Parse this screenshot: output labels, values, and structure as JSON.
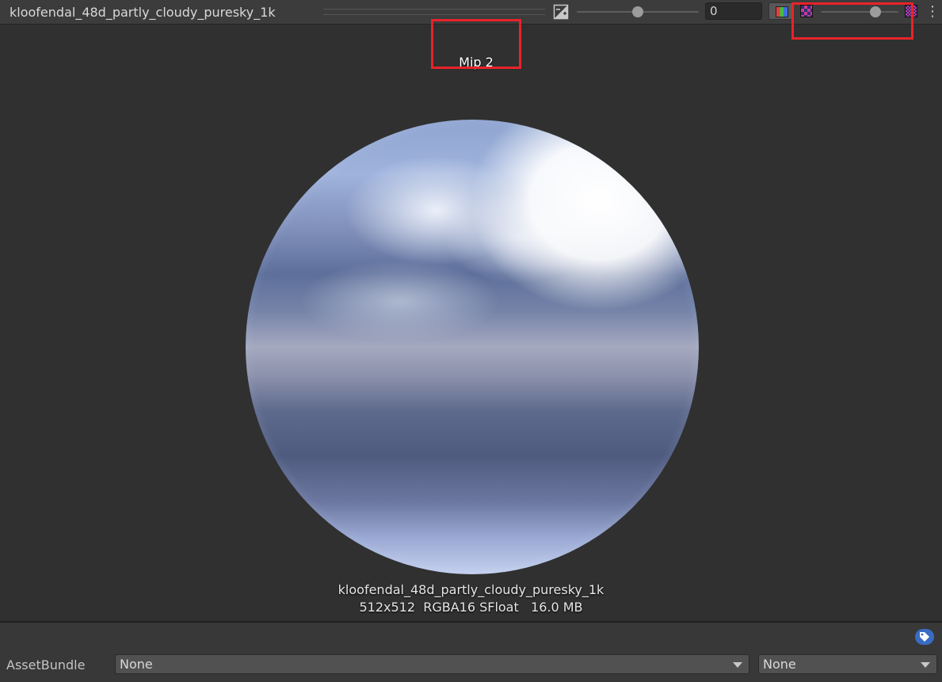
{
  "toolbar": {
    "title": "kloofendal_48d_partly_cloudy_puresky_1k",
    "exposure_icon": "exposure-icon",
    "exposure_value": "0",
    "exposure_slider_level": 0.5,
    "channel_icon": "rgb-channels-icon",
    "mip_small_icon": "mip-small-checker-icon",
    "mip_large_icon": "mip-large-checker-icon",
    "mip_slider_level": 0.7,
    "more_icon": "more-vertical-icon",
    "more_glyph": "⋮",
    "highlight_color": "#e8232a"
  },
  "preview": {
    "mip_label": "Mip 2",
    "asset_name": "kloofendal_48d_partly_cloudy_puresky_1k",
    "asset_info": "512x512  RGBA16 SFloat   16.0 MB"
  },
  "bottom": {
    "label_icon": "tag-icon",
    "asset_bundle_label": "AssetBundle",
    "bundle_value": "None",
    "variant_value": "None"
  }
}
